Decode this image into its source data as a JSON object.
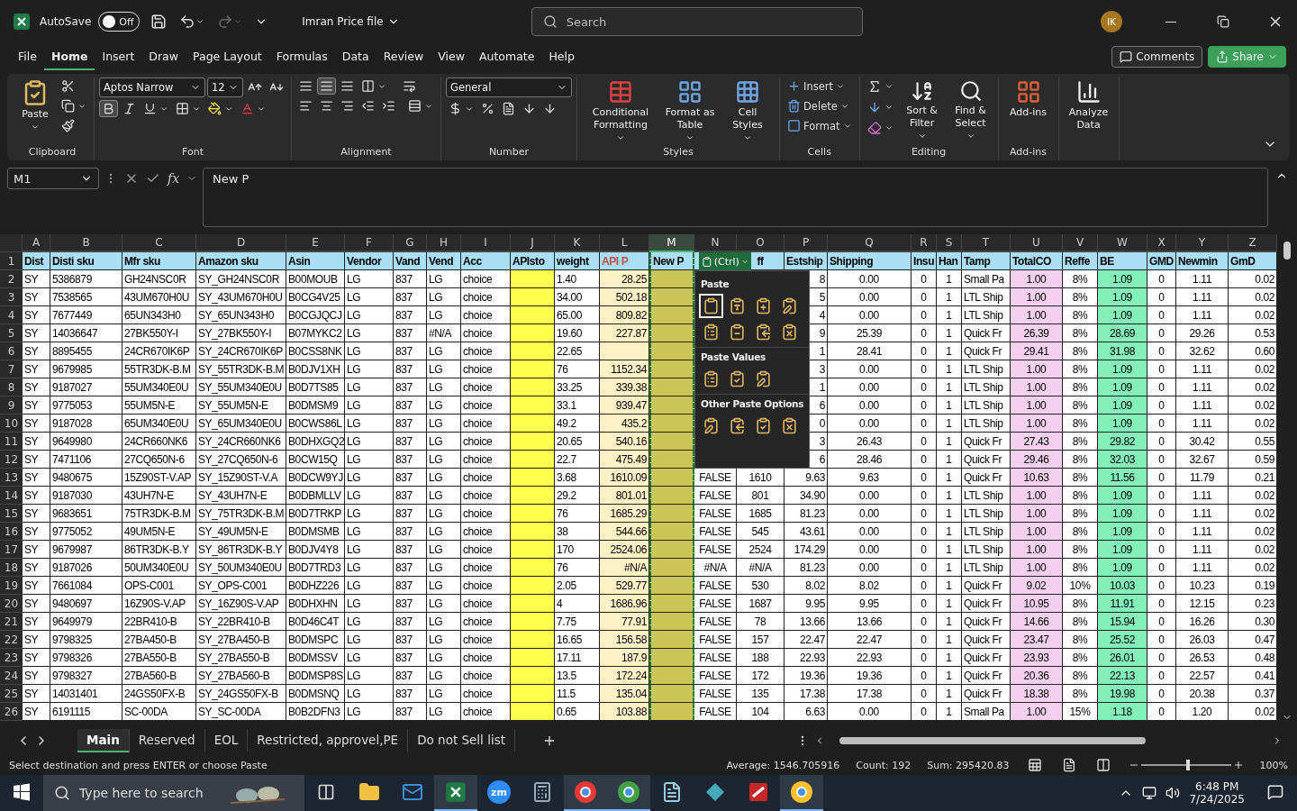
{
  "titlebar": {
    "autosave": {
      "label": "AutoSave",
      "on": false,
      "state": "Off"
    },
    "file": "Imran Price file",
    "search": {
      "placeholder": "Search"
    },
    "avatar": "IK"
  },
  "menu": [
    {
      "label": "File",
      "selected": false
    },
    {
      "label": "Home",
      "selected": true
    },
    {
      "label": "Insert",
      "selected": false
    },
    {
      "label": "Draw",
      "selected": false
    },
    {
      "label": "Page Layout",
      "selected": false
    },
    {
      "label": "Formulas",
      "selected": false
    },
    {
      "label": "Data",
      "selected": false
    },
    {
      "label": "Review",
      "selected": false
    },
    {
      "label": "View",
      "selected": false
    },
    {
      "label": "Automate",
      "selected": false
    },
    {
      "label": "Help",
      "selected": false
    }
  ],
  "actions": {
    "comments": "Comments",
    "share": "Share"
  },
  "ribbon": {
    "clipboard": {
      "label": "Clipboard",
      "paste": "Paste"
    },
    "font": {
      "label": "Font",
      "name": "Aptos Narrow",
      "size": "12",
      "bold": true
    },
    "alignment": {
      "label": "Alignment",
      "middle": true
    },
    "number": {
      "label": "Number",
      "format": "General"
    },
    "styles": {
      "label": "Styles",
      "buttons": [
        "Conditional Formatting",
        "Format as Table",
        "Cell Styles"
      ]
    },
    "cells": {
      "label": "Cells",
      "buttons": [
        "Insert",
        "Delete",
        "Format"
      ]
    },
    "editing": {
      "label": "Editing",
      "buttons": [
        "Sort & Filter",
        "Find & Select"
      ]
    },
    "addins": {
      "label": "Add-ins",
      "buttons": [
        "Add-ins"
      ]
    },
    "analyze": {
      "buttons": [
        "Analyze Data"
      ]
    }
  },
  "formula_bar": {
    "name_box": "M1",
    "fx": "fx",
    "value": "New P"
  },
  "header_row": "1",
  "columns": [
    {
      "letter": "A",
      "header": {
        "text": "Dist"
      },
      "selected": false
    },
    {
      "letter": "B",
      "header": {
        "text": "Disti sku"
      },
      "selected": false
    },
    {
      "letter": "C",
      "header": {
        "text": "Mfr sku"
      },
      "selected": false
    },
    {
      "letter": "D",
      "header": {
        "text": "Amazon sku"
      },
      "selected": false
    },
    {
      "letter": "E",
      "header": {
        "text": "Asin"
      },
      "selected": false
    },
    {
      "letter": "F",
      "header": {
        "text": "Vendor"
      },
      "selected": false
    },
    {
      "letter": "G",
      "header": {
        "text": "Vand"
      },
      "selected": false
    },
    {
      "letter": "H",
      "header": {
        "text": "Vend"
      },
      "selected": false
    },
    {
      "letter": "I",
      "header": {
        "text": "Acc"
      },
      "selected": false
    },
    {
      "letter": "J",
      "header": {
        "text": "APIsto"
      },
      "selected": false,
      "color": "#ffff4d"
    },
    {
      "letter": "K",
      "header": {
        "text": "weight"
      },
      "selected": false
    },
    {
      "letter": "L",
      "header": {
        "text": "API P",
        "color": "#c0504d"
      },
      "selected": false,
      "color": "#fff2c6"
    },
    {
      "letter": "M",
      "header": {
        "text": "New P"
      },
      "selected": true,
      "color": "#cbc558"
    },
    {
      "letter": "N",
      "selected": false
    },
    {
      "letter": "O",
      "header": {
        "text": "ff"
      },
      "selected": false
    },
    {
      "letter": "P",
      "header": {
        "text": "Estship"
      },
      "selected": false
    },
    {
      "letter": "Q",
      "header": {
        "text": "Shipping"
      },
      "selected": false
    },
    {
      "letter": "R",
      "header": {
        "text": "Insu"
      },
      "selected": false
    },
    {
      "letter": "S",
      "header": {
        "text": "Han"
      },
      "selected": false
    },
    {
      "letter": "T",
      "header": {
        "text": "Tamp"
      },
      "selected": false
    },
    {
      "letter": "U",
      "header": {
        "text": "TotalCO"
      },
      "selected": false,
      "color": "#f2d0ee"
    },
    {
      "letter": "V",
      "header": {
        "text": "Reffe"
      },
      "selected": false
    },
    {
      "letter": "W",
      "header": {
        "text": "BE"
      },
      "selected": false,
      "color": "#84efb8"
    },
    {
      "letter": "X",
      "header": {
        "text": "GMD"
      },
      "selected": false
    },
    {
      "letter": "Y",
      "header": {
        "text": "Newmin"
      },
      "selected": false
    },
    {
      "letter": "Z",
      "header": {
        "text": "GmD"
      },
      "selected": false
    }
  ],
  "rows": [
    {
      "n": "2",
      "cells": [
        "SY",
        "5386879",
        "GH24NSC0R",
        "SY_GH24NSC0R",
        "B00MOUB",
        "LG",
        "837",
        "LG",
        "choice",
        null,
        "1.40",
        "28.25",
        null,
        null,
        null,
        "8",
        "0.00",
        "0",
        "1",
        "Small Pa",
        "1.00",
        "8%",
        "1.09",
        "0",
        "1.11",
        "0.02"
      ]
    },
    {
      "n": "3",
      "cells": [
        "SY",
        "7538565",
        "43UM670H0U",
        "SY_43UM670H0U",
        "B0CG4V25",
        "LG",
        "837",
        "LG",
        "choice",
        null,
        "34.00",
        "502.18",
        null,
        null,
        null,
        "5",
        "0.00",
        "0",
        "1",
        "LTL Ship",
        "1.00",
        "8%",
        "1.09",
        "0",
        "1.11",
        "0.02"
      ]
    },
    {
      "n": "4",
      "cells": [
        "SY",
        "7677449",
        "65UN343H0",
        "SY_65UN343H0",
        "B0CGJQCJ",
        "LG",
        "837",
        "LG",
        "choice",
        null,
        "65.00",
        "809.82",
        null,
        null,
        null,
        "4",
        "0.00",
        "0",
        "1",
        "LTL Ship",
        "1.00",
        "8%",
        "1.09",
        "0",
        "1.11",
        "0.02"
      ]
    },
    {
      "n": "5",
      "cells": [
        "SY",
        "14036647",
        "27BK550Y-I",
        "SY_27BK550Y-I",
        "B07MYKC2",
        "LG",
        "837",
        "#N/A",
        "choice",
        null,
        "19.60",
        "227.87",
        null,
        null,
        null,
        "9",
        "25.39",
        "0",
        "1",
        "Quick Fr",
        "26.39",
        "8%",
        "28.69",
        "0",
        "29.26",
        "0.53"
      ]
    },
    {
      "n": "6",
      "cells": [
        "SY",
        "8895455",
        "24CR670IK6P",
        "SY_24CR670IK6P",
        "B0CSS8NK",
        "LG",
        "837",
        "LG",
        "choice",
        null,
        "22.65",
        null,
        null,
        null,
        null,
        "1",
        "28.41",
        "0",
        "1",
        "Quick Fr",
        "29.41",
        "8%",
        "31.98",
        "0",
        "32.62",
        "0.60"
      ]
    },
    {
      "n": "7",
      "cells": [
        "SY",
        "9679985",
        "55TR3DK-B.M",
        "SY_55TR3DK-B.M",
        "B0DJV1XH",
        "LG",
        "837",
        "LG",
        "choice",
        null,
        "76",
        "1152.34",
        null,
        null,
        null,
        "3",
        "0.00",
        "0",
        "1",
        "LTL Ship",
        "1.00",
        "8%",
        "1.09",
        "0",
        "1.11",
        "0.02"
      ]
    },
    {
      "n": "8",
      "cells": [
        "SY",
        "9187027",
        "55UM340E0U",
        "SY_55UM340E0U",
        "B0D7TS85",
        "LG",
        "837",
        "LG",
        "choice",
        null,
        "33.25",
        "339.38",
        null,
        null,
        null,
        "1",
        "0.00",
        "0",
        "1",
        "LTL Ship",
        "1.00",
        "8%",
        "1.09",
        "0",
        "1.11",
        "0.02"
      ]
    },
    {
      "n": "9",
      "cells": [
        "SY",
        "9775053",
        "55UM5N-E",
        "SY_55UM5N-E",
        "B0DMSM9",
        "LG",
        "837",
        "LG",
        "choice",
        null,
        "33.1",
        "939.47",
        null,
        null,
        null,
        "6",
        "0.00",
        "0",
        "1",
        "LTL Ship",
        "1.00",
        "8%",
        "1.09",
        "0",
        "1.11",
        "0.02"
      ]
    },
    {
      "n": "10",
      "cells": [
        "SY",
        "9187028",
        "65UM340E0U",
        "SY_65UM340E0U",
        "B0CWS86L",
        "LG",
        "837",
        "LG",
        "choice",
        null,
        "49.2",
        "435.2",
        null,
        null,
        null,
        "0",
        "0.00",
        "0",
        "1",
        "LTL Ship",
        "1.00",
        "8%",
        "1.09",
        "0",
        "1.11",
        "0.02"
      ]
    },
    {
      "n": "11",
      "cells": [
        "SY",
        "9649980",
        "24CR660NK6",
        "SY_24CR660NK6",
        "B0DHXGQ2",
        "LG",
        "837",
        "LG",
        "choice",
        null,
        "20.65",
        "540.16",
        null,
        null,
        null,
        "3",
        "26.43",
        "0",
        "1",
        "Quick Fr",
        "27.43",
        "8%",
        "29.82",
        "0",
        "30.42",
        "0.55"
      ]
    },
    {
      "n": "12",
      "cells": [
        "SY",
        "7471106",
        "27CQ650N-6",
        "SY_27CQ650N-6",
        "B0CW15Q",
        "LG",
        "837",
        "LG",
        "choice",
        null,
        "22.7",
        "475.49",
        null,
        null,
        null,
        "6",
        "28.46",
        "0",
        "1",
        "Quick Fr",
        "29.46",
        "8%",
        "32.03",
        "0",
        "32.67",
        "0.59"
      ]
    },
    {
      "n": "13",
      "cells": [
        "SY",
        "9480675",
        "15Z90ST-V.AP",
        "SY_15Z90ST-V.A",
        "B0DCW9YJ",
        "LG",
        "837",
        "LG",
        "choice",
        null,
        "3.68",
        "1610.09",
        null,
        "FALSE",
        "1610",
        "9.63",
        "9.63",
        "0",
        "1",
        "Quick Fr",
        "10.63",
        "8%",
        "11.56",
        "0",
        "11.79",
        "0.21"
      ]
    },
    {
      "n": "14",
      "cells": [
        "SY",
        "9187030",
        "43UH7N-E",
        "SY_43UH7N-E",
        "B0DBMLLV",
        "LG",
        "837",
        "LG",
        "choice",
        null,
        "29.2",
        "801.01",
        null,
        "FALSE",
        "801",
        "34.90",
        "0.00",
        "0",
        "1",
        "LTL Ship",
        "1.00",
        "8%",
        "1.09",
        "0",
        "1.11",
        "0.02"
      ]
    },
    {
      "n": "15",
      "cells": [
        "SY",
        "9683651",
        "75TR3DK-B.M",
        "SY_75TR3DK-B.M",
        "B0D7TRKP",
        "LG",
        "837",
        "LG",
        "choice",
        null,
        "76",
        "1685.29",
        null,
        "FALSE",
        "1685",
        "81.23",
        "0.00",
        "0",
        "1",
        "LTL Ship",
        "1.00",
        "8%",
        "1.09",
        "0",
        "1.11",
        "0.02"
      ]
    },
    {
      "n": "16",
      "cells": [
        "SY",
        "9775052",
        "49UM5N-E",
        "SY_49UM5N-E",
        "B0DMSMB",
        "LG",
        "837",
        "LG",
        "choice",
        null,
        "38",
        "544.66",
        null,
        "FALSE",
        "545",
        "43.61",
        "0.00",
        "0",
        "1",
        "LTL Ship",
        "1.00",
        "8%",
        "1.09",
        "0",
        "1.11",
        "0.02"
      ]
    },
    {
      "n": "17",
      "cells": [
        "SY",
        "9679987",
        "86TR3DK-B.Y",
        "SY_86TR3DK-B.Y",
        "B0DJV4Y8",
        "LG",
        "837",
        "LG",
        "choice",
        null,
        "170",
        "2524.06",
        null,
        "FALSE",
        "2524",
        "174.29",
        "0.00",
        "0",
        "1",
        "LTL Ship",
        "1.00",
        "8%",
        "1.09",
        "0",
        "1.11",
        "0.02"
      ]
    },
    {
      "n": "18",
      "cells": [
        "SY",
        "9187026",
        "50UM340E0U",
        "SY_50UM340E0U",
        "B0D7TRD3",
        "LG",
        "837",
        "LG",
        "choice",
        null,
        "76",
        "#N/A",
        null,
        "#N/A",
        "#N/A",
        "81.23",
        "0.00",
        "0",
        "1",
        "LTL Ship",
        "1.00",
        "8%",
        "1.09",
        "0",
        "1.11",
        "0.02"
      ]
    },
    {
      "n": "19",
      "cells": [
        "SY",
        "7661084",
        "OPS-C001",
        "SY_OPS-C001",
        "B0DHZ226",
        "LG",
        "837",
        "LG",
        "choice",
        null,
        "2.05",
        "529.77",
        null,
        "FALSE",
        "530",
        "8.02",
        "8.02",
        "0",
        "1",
        "Quick Fr",
        "9.02",
        "10%",
        "10.03",
        "0",
        "10.23",
        "0.19"
      ]
    },
    {
      "n": "20",
      "cells": [
        "SY",
        "9480697",
        "16Z90S-V.AP",
        "SY_16Z90S-V.AP",
        "B0DHXHN",
        "LG",
        "837",
        "LG",
        "choice",
        null,
        "4",
        "1686.96",
        null,
        "FALSE",
        "1687",
        "9.95",
        "9.95",
        "0",
        "1",
        "Quick Fr",
        "10.95",
        "8%",
        "11.91",
        "0",
        "12.15",
        "0.23"
      ]
    },
    {
      "n": "21",
      "cells": [
        "SY",
        "9649979",
        "22BR410-B",
        "SY_22BR410-B",
        "B0D46C4T",
        "LG",
        "837",
        "LG",
        "choice",
        null,
        "7.75",
        "77.91",
        null,
        "FALSE",
        "78",
        "13.66",
        "13.66",
        "0",
        "1",
        "Quick Fr",
        "14.66",
        "8%",
        "15.94",
        "0",
        "16.26",
        "0.30"
      ]
    },
    {
      "n": "22",
      "cells": [
        "SY",
        "9798325",
        "27BA450-B",
        "SY_27BA450-B",
        "B0DMSPC",
        "LG",
        "837",
        "LG",
        "choice",
        null,
        "16.65",
        "156.58",
        null,
        "FALSE",
        "157",
        "22.47",
        "22.47",
        "0",
        "1",
        "Quick Fr",
        "23.47",
        "8%",
        "25.52",
        "0",
        "26.03",
        "0.47"
      ]
    },
    {
      "n": "23",
      "cells": [
        "SY",
        "9798326",
        "27BA550-B",
        "SY_27BA550-B",
        "B0DMSSV",
        "LG",
        "837",
        "LG",
        "choice",
        null,
        "17.11",
        "187.9",
        null,
        "FALSE",
        "188",
        "22.93",
        "22.93",
        "0",
        "1",
        "Quick Fr",
        "23.93",
        "8%",
        "26.01",
        "0",
        "26.53",
        "0.48"
      ]
    },
    {
      "n": "24",
      "cells": [
        "SY",
        "9798327",
        "27BA560-B",
        "SY_27BA560-B",
        "B0DMSP8S",
        "LG",
        "837",
        "LG",
        "choice",
        null,
        "13.5",
        "172.24",
        null,
        "FALSE",
        "172",
        "19.36",
        "19.36",
        "0",
        "1",
        "Quick Fr",
        "20.36",
        "8%",
        "22.13",
        "0",
        "22.57",
        "0.41"
      ]
    },
    {
      "n": "25",
      "cells": [
        "SY",
        "14031401",
        "24GS50FX-B",
        "SY_24GS50FX-B",
        "B0DMSNQ",
        "LG",
        "837",
        "LG",
        "choice",
        null,
        "11.5",
        "135.04",
        null,
        "FALSE",
        "135",
        "17.38",
        "17.38",
        "0",
        "1",
        "Quick Fr",
        "18.38",
        "8%",
        "19.98",
        "0",
        "20.38",
        "0.37"
      ]
    },
    {
      "n": "26",
      "cells": [
        "SY",
        "6191115",
        "SC-00DA",
        "SY_SC-00DA",
        "B0B2DFN3",
        "LG",
        "837",
        "LG",
        "choice",
        null,
        "0.65",
        "103.88",
        null,
        "FALSE",
        "104",
        "6.63",
        "0.00",
        "0",
        "1",
        "Small Pa",
        "1.00",
        "15%",
        "1.18",
        "0",
        "1.20",
        "0.02"
      ]
    }
  ],
  "paste_menu": {
    "button": "(Ctrl)",
    "sections": [
      {
        "title": "Paste",
        "options": [
          {
            "selected": true
          },
          {
            "selected": false
          },
          {
            "selected": false
          },
          {
            "selected": false
          },
          {
            "selected": false
          },
          {
            "selected": false
          },
          {
            "selected": false
          },
          {
            "selected": false
          }
        ]
      },
      {
        "title": "Paste Values",
        "options": [
          {
            "selected": false
          },
          {
            "selected": false
          },
          {
            "selected": false
          }
        ]
      },
      {
        "title": "Other Paste Options",
        "options": [
          {
            "selected": false
          },
          {
            "selected": false
          },
          {
            "selected": false
          },
          {
            "selected": false
          }
        ]
      }
    ]
  },
  "sheets": [
    {
      "label": "Main",
      "selected": true
    },
    {
      "label": "Reserved",
      "selected": false
    },
    {
      "label": "EOL",
      "selected": false
    },
    {
      "label": "Restricted, approvel,PE",
      "selected": false
    },
    {
      "label": "Do not Sell list",
      "selected": false
    }
  ],
  "status_bar": {
    "message": "Select destination and press ENTER or choose Paste",
    "average": "Average: 1546.705916",
    "count": "Count: 192",
    "sum": "Sum: 295420.83",
    "zoom": {
      "level": 0.5,
      "reading": "100%"
    }
  },
  "taskbar": {
    "search": {
      "placeholder": "Type here to search"
    },
    "zoom_app": "zm",
    "time": "6:48 PM",
    "date": "7/24/2025"
  }
}
